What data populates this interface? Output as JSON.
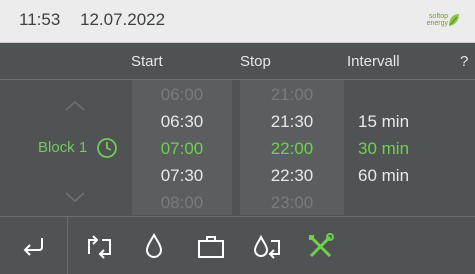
{
  "status": {
    "time": "11:53",
    "date": "12.07.2022"
  },
  "logo": {
    "line1": "softop",
    "line2": "energy"
  },
  "columns": {
    "start": "Start",
    "stop": "Stop",
    "interval": "Intervall",
    "help": "?"
  },
  "block": {
    "label": "Block 1"
  },
  "start_times": [
    {
      "value": "06:00",
      "state": "faded"
    },
    {
      "value": "06:30",
      "state": "normal"
    },
    {
      "value": "07:00",
      "state": "selected"
    },
    {
      "value": "07:30",
      "state": "normal"
    },
    {
      "value": "08:00",
      "state": "faded"
    }
  ],
  "stop_times": [
    {
      "value": "21:00",
      "state": "faded"
    },
    {
      "value": "21:30",
      "state": "normal"
    },
    {
      "value": "22:00",
      "state": "selected"
    },
    {
      "value": "22:30",
      "state": "normal"
    },
    {
      "value": "23:00",
      "state": "faded"
    }
  ],
  "intervals": [
    {
      "value": "15 min",
      "state": "normal"
    },
    {
      "value": "30 min",
      "state": "selected"
    },
    {
      "value": "60 min",
      "state": "normal"
    }
  ],
  "toolbar": {
    "icons": [
      "back-icon",
      "swap-icon",
      "drop-icon",
      "suitcase-icon",
      "drop-swap-icon",
      "tools-icon"
    ]
  },
  "colors": {
    "accent": "#6fd050",
    "background": "#4f5354",
    "status_bar": "#ececec"
  }
}
